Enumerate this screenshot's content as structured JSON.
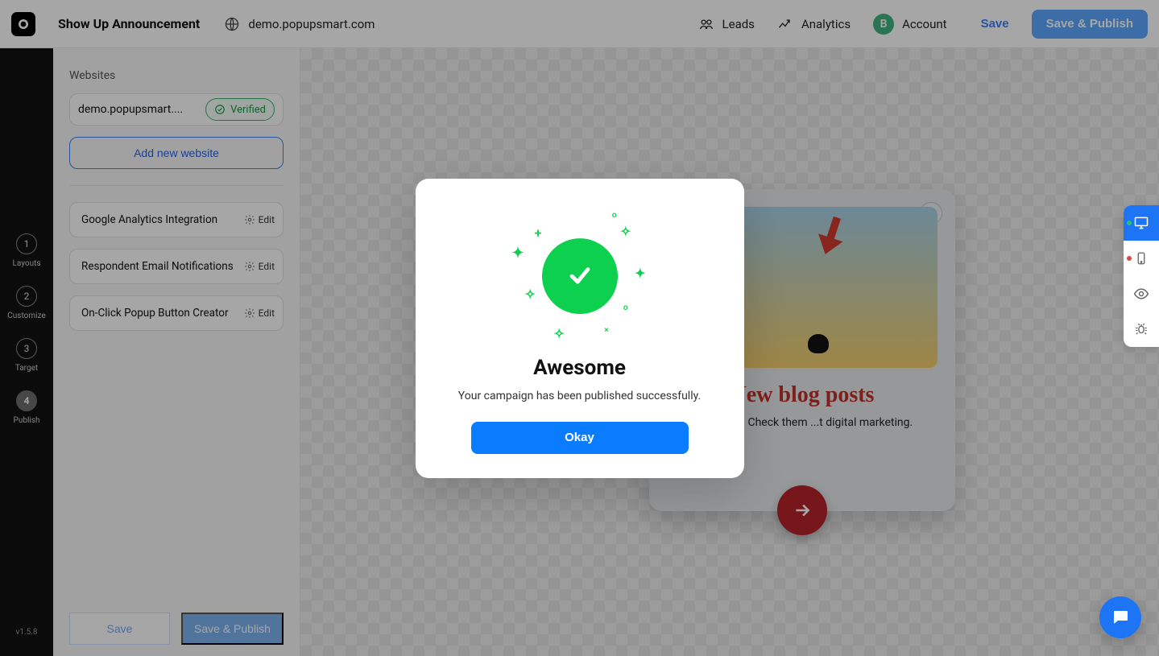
{
  "header": {
    "campaign_name": "Show Up Announcement",
    "domain": "demo.popupsmart.com",
    "nav": {
      "leads": "Leads",
      "analytics": "Analytics",
      "account": "Account",
      "avatar_initial": "B"
    },
    "buttons": {
      "save": "Save",
      "publish": "Save & Publish"
    }
  },
  "steps": [
    {
      "num": "1",
      "label": "Layouts"
    },
    {
      "num": "2",
      "label": "Customize"
    },
    {
      "num": "3",
      "label": "Target"
    },
    {
      "num": "4",
      "label": "Publish"
    }
  ],
  "active_step_index": 3,
  "version": "v1.5.8",
  "sidebar": {
    "section_title": "Websites",
    "website": "demo.popupsmart....",
    "verified_label": "Verified",
    "add_website": "Add new website",
    "options": [
      {
        "title": "Google Analytics Integration",
        "action": "Edit"
      },
      {
        "title": "Respondent Email Notifications",
        "action": "Edit"
      },
      {
        "title": "On-Click Popup Button Creator",
        "action": "Edit"
      }
    ],
    "footer": {
      "save": "Save",
      "publish": "Save & Publish"
    }
  },
  "preview": {
    "headline": "New blog posts",
    "subtext": "...d by you! Check them ...t digital marketing."
  },
  "modal": {
    "title": "Awesome",
    "body": "Your campaign has been published successfully.",
    "okay": "Okay"
  }
}
